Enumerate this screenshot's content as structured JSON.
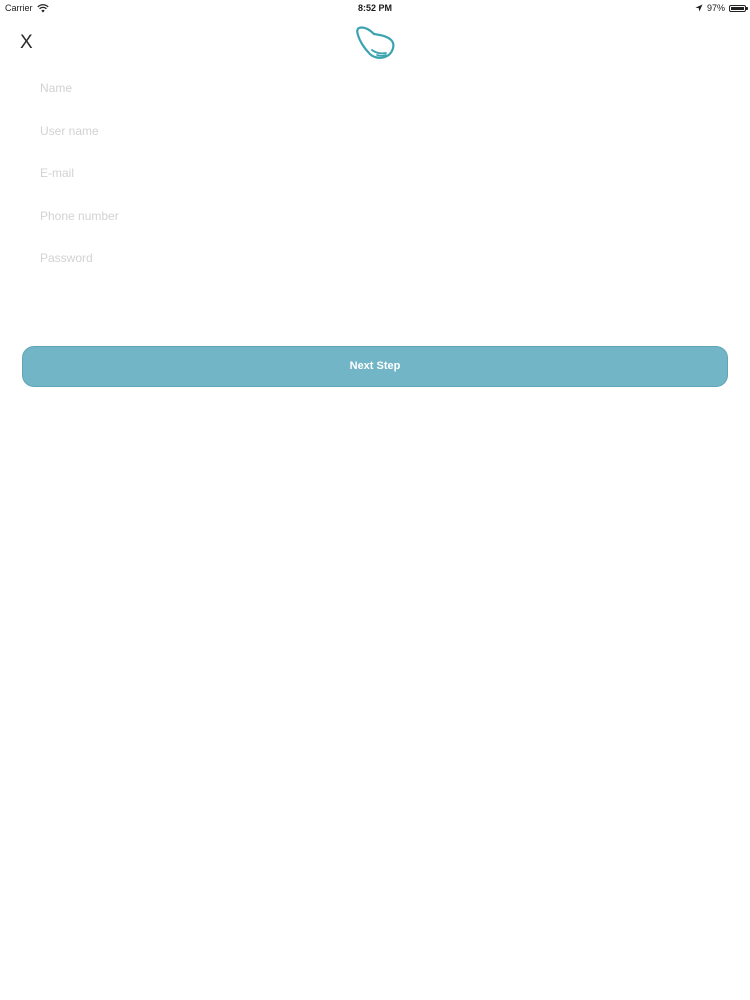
{
  "status_bar": {
    "carrier": "Carrier",
    "time": "8:52 PM",
    "battery_percent": "97%",
    "battery_level": 0.97,
    "icons": [
      "wifi-icon",
      "location-arrow-icon",
      "battery-icon"
    ]
  },
  "header": {
    "close_label": "X",
    "logo": "wing-logo-icon"
  },
  "form": {
    "name_placeholder": "Name",
    "username_placeholder": "User name",
    "email_placeholder": "E-mail",
    "phone_placeholder": "Phone number",
    "password_placeholder": "Password"
  },
  "actions": {
    "next_label": "Next Step"
  },
  "colors": {
    "accent": "#72b5c6",
    "logo_stroke": "#3aa3b0",
    "placeholder": "#d2d2d2"
  }
}
